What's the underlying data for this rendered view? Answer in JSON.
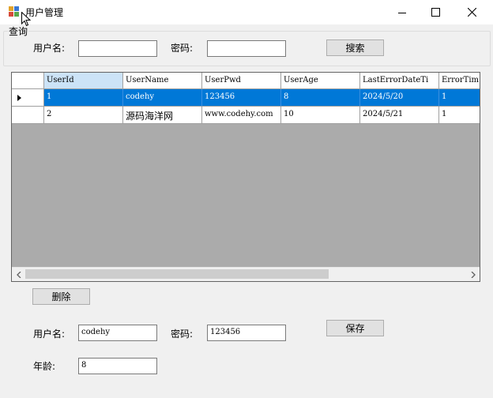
{
  "window": {
    "title": "用户管理"
  },
  "query": {
    "group_label": "查询",
    "username_label": "用户名:",
    "username_value": "",
    "password_label": "密码:",
    "password_value": "",
    "search_label": "搜索"
  },
  "grid": {
    "columns": [
      "UserId",
      "UserName",
      "UserPwd",
      "UserAge",
      "LastErrorDateTi",
      "ErrorTim"
    ],
    "rows": [
      [
        "1",
        "codehy",
        "123456",
        "8",
        "2024/5/20",
        "1"
      ],
      [
        "2",
        "源码海洋网",
        "www.codehy.com",
        "10",
        "2024/5/21",
        "1"
      ]
    ]
  },
  "actions": {
    "delete_label": "删除",
    "save_label": "保存"
  },
  "edit": {
    "username_label": "用户名:",
    "username_value": "codehy",
    "password_label": "密码:",
    "password_value": "123456",
    "age_label": "年龄:",
    "age_value": "8"
  },
  "colors": {
    "selection": "#0078d7",
    "grid_background": "#ababab",
    "header_selected": "#cce3f7"
  }
}
